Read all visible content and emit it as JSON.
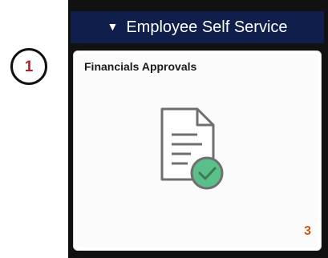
{
  "callout": {
    "step_number": "1"
  },
  "section": {
    "title": "Employee Self Service",
    "expand_icon": "triangle-down-icon"
  },
  "tile": {
    "title": "Financials Approvals",
    "icon": "approved-document-icon",
    "badge_count": "3"
  },
  "colors": {
    "header_bg": "#0f1e4a",
    "count_color": "#c55a11",
    "check_green": "#5bbf8a",
    "callout_number": "#b3202a"
  }
}
